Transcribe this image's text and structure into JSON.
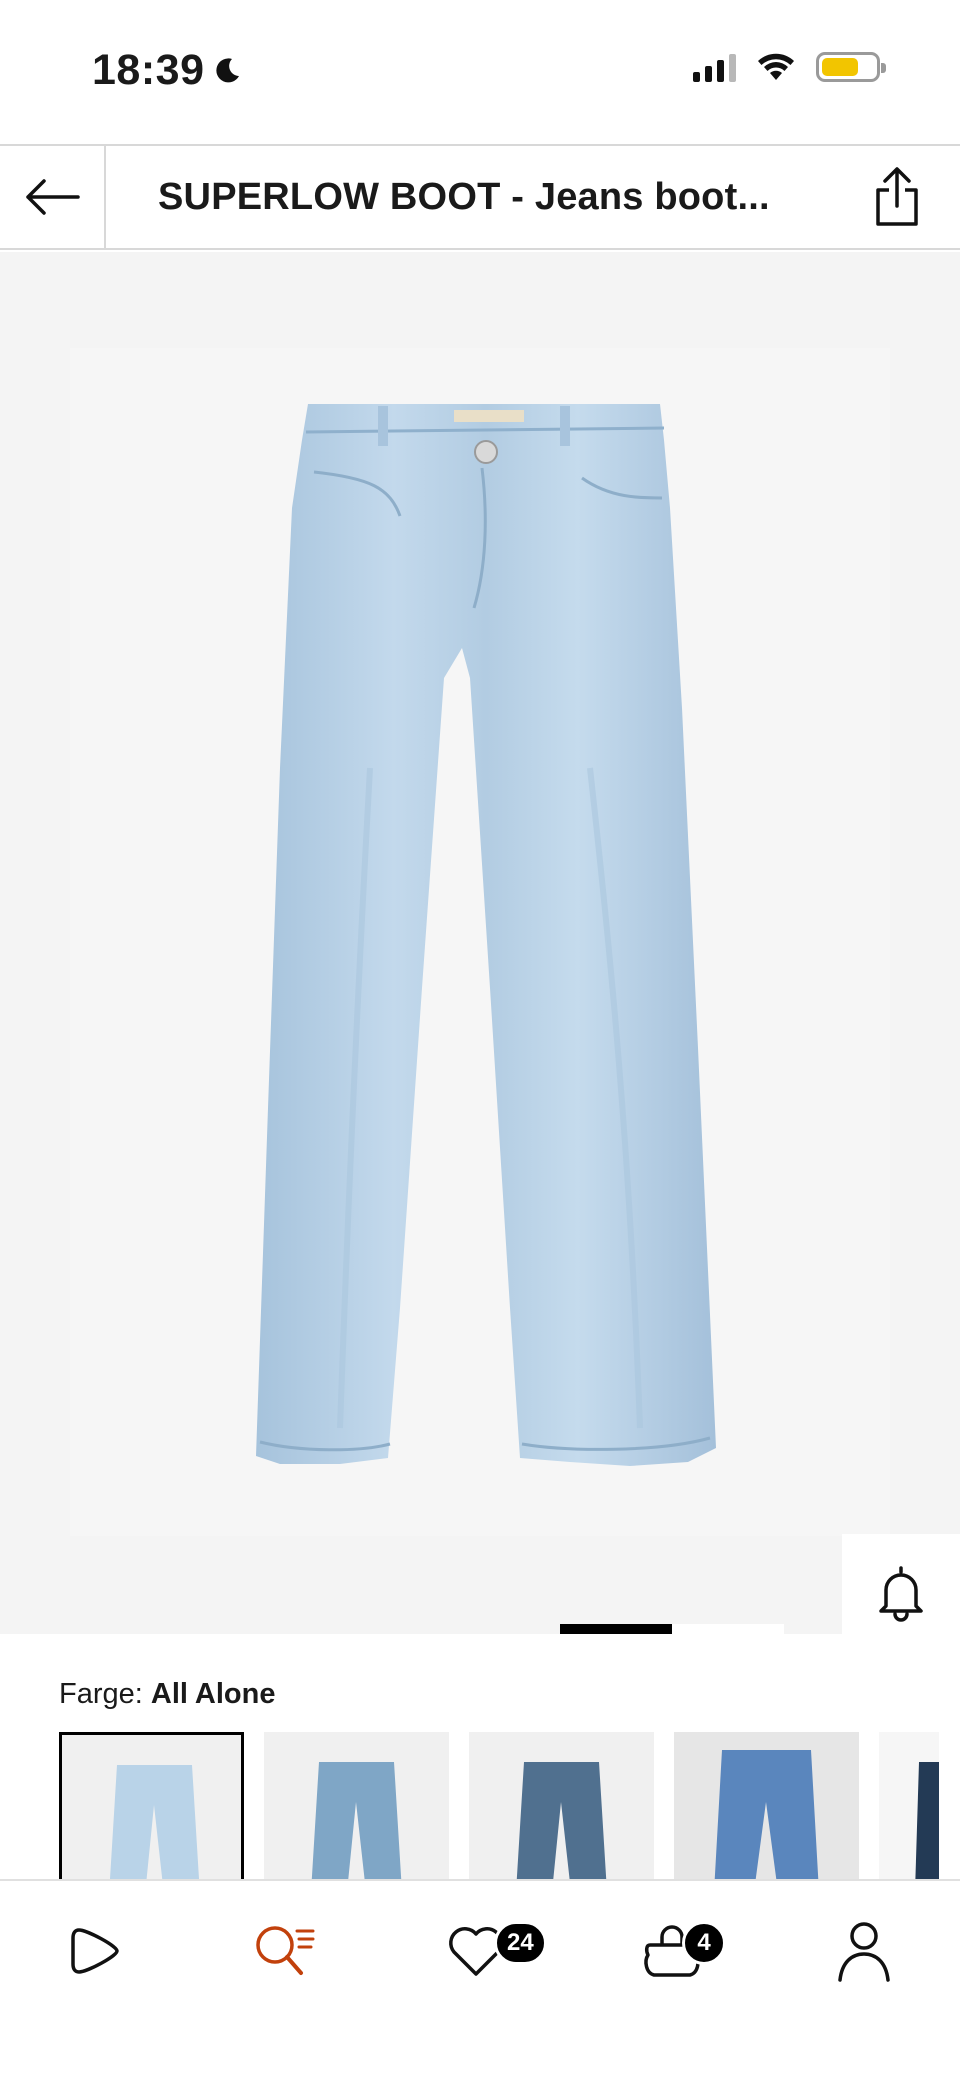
{
  "status_bar": {
    "time": "18:39",
    "moon_icon": "moon-icon",
    "battery_color": "#f2c500"
  },
  "header": {
    "title": "SUPERLOW BOOT - Jeans boot...",
    "back_icon": "arrow-left-icon",
    "share_icon": "share-icon"
  },
  "product_image": {
    "icon": "jeans-image",
    "denim_color": "#b9d3e8"
  },
  "actions": {
    "ai_icon": "ai-sparkle-chat-icon",
    "notify_icon": "bell-icon",
    "wishlist_icon": "heart-icon",
    "bag_icon": "shopping-bag-icon"
  },
  "gallery": {
    "active_index": 1,
    "total": 2
  },
  "color": {
    "label": "Farge:",
    "value": "All Alone",
    "swatches": [
      {
        "shade": "#b9d3e8",
        "selected": true
      },
      {
        "shade": "#7fa6c6",
        "selected": false
      },
      {
        "shade": "#50708f",
        "selected": false
      },
      {
        "shade": "#5a86bd",
        "selected": false
      },
      {
        "shade": "#233a55",
        "selected": false
      }
    ]
  },
  "bottom_nav": {
    "items": [
      {
        "name": "home",
        "icon": "play-logo-icon"
      },
      {
        "name": "search",
        "icon": "search-list-icon",
        "active": true,
        "color": "#c2410c"
      },
      {
        "name": "wishlist",
        "icon": "heart-icon",
        "badge": "24"
      },
      {
        "name": "bag",
        "icon": "shopping-bag-icon",
        "badge": "4"
      },
      {
        "name": "account",
        "icon": "user-icon"
      }
    ]
  }
}
